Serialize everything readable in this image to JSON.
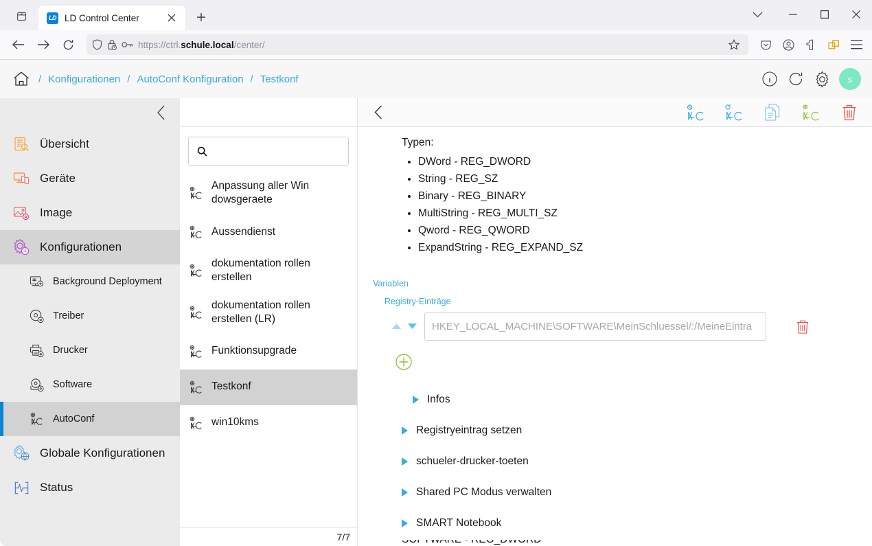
{
  "browser": {
    "tab": {
      "title": "LD Control Center",
      "favicon_text": "LD"
    },
    "list_all_tabs_tooltip": "List all tabs",
    "new_tab_label": "+",
    "url": {
      "scheme": "https://",
      "host_pre": "ctrl.",
      "host_bold": "schule.local",
      "path": "/center/"
    },
    "toolbar_icons": [
      "pocket-icon",
      "account-icon",
      "extensions-icon",
      "container-tabs-icon",
      "app-menu-icon"
    ],
    "nav_icons": [
      "back-icon",
      "forward-icon",
      "reload-icon"
    ],
    "window_controls": [
      "chevron-down-icon",
      "minimize-icon",
      "maximize-icon",
      "close-icon"
    ]
  },
  "app": {
    "breadcrumb": {
      "home_icon": "home-icon",
      "items": [
        "Konfigurationen",
        "AutoConf Konfiguration",
        "Testkonf"
      ],
      "separator": "/"
    },
    "header_actions": [
      "info-icon",
      "refresh-icon",
      "gear-icon"
    ],
    "avatar_initial": "s",
    "accent_blue": "#3aa9e8",
    "sidebar": {
      "collapse_icon": "chevron-left-icon",
      "items": [
        {
          "label": "Übersicht",
          "icon": "overview-icon",
          "level": "top",
          "active": false
        },
        {
          "label": "Geräte",
          "icon": "devices-icon",
          "level": "top",
          "active": false
        },
        {
          "label": "Image",
          "icon": "image-icon",
          "level": "top",
          "active": false
        },
        {
          "label": "Konfigurationen",
          "icon": "configurations-icon",
          "level": "top",
          "active": true
        },
        {
          "label": "Background Deployment",
          "icon": "background-deployment-icon",
          "level": "sub",
          "active": false
        },
        {
          "label": "Treiber",
          "icon": "driver-icon",
          "level": "sub",
          "active": false
        },
        {
          "label": "Drucker",
          "icon": "printer-icon",
          "level": "sub",
          "active": false
        },
        {
          "label": "Software",
          "icon": "software-icon",
          "level": "sub",
          "active": false
        },
        {
          "label": "AutoConf",
          "icon": "autoconf-icon",
          "level": "sub",
          "active": true
        },
        {
          "label": "Globale Konfigurationen",
          "icon": "global-configurations-icon",
          "level": "top",
          "active": false
        },
        {
          "label": "Status",
          "icon": "status-icon",
          "level": "top",
          "active": false
        }
      ]
    },
    "list_panel": {
      "collapse_icon": "chevron-left-icon",
      "search": {
        "placeholder": "",
        "value": "",
        "icon": "search-icon"
      },
      "items": [
        {
          "label": "Anpassung aller Win dowsgeraete",
          "selected": false
        },
        {
          "label": "Aussendienst",
          "selected": false
        },
        {
          "label": "dokumentation rollen erstellen",
          "selected": false
        },
        {
          "label": "dokumentation rollen erstellen (LR)",
          "selected": false
        },
        {
          "label": "Funktionsupgrade",
          "selected": false
        },
        {
          "label": "Testkonf",
          "selected": true
        },
        {
          "label": "win10kms",
          "selected": false
        }
      ],
      "counter": "7/7"
    },
    "main_panel": {
      "back_icon": "chevron-left-icon",
      "actions": [
        {
          "name": "autoconf-disable-icon",
          "color": "#3aa9e8"
        },
        {
          "name": "autoconf-refresh-icon",
          "color": "#3aa9e8"
        },
        {
          "name": "duplicate-icon",
          "color": "#8ec8ee"
        },
        {
          "name": "autoconf-settings-icon",
          "color": "#8cc63f"
        },
        {
          "name": "delete-icon",
          "color": "#ef5350"
        }
      ],
      "types_label": "Typen:",
      "types": [
        "DWord - REG_DWORD",
        "String - REG_SZ",
        "Binary - REG_BINARY",
        "MultiString - REG_MULTI_SZ",
        "Qword - REG_QWORD",
        "ExpandString - REG_EXPAND_SZ"
      ],
      "variables_label": "Variablen",
      "registry_label": "Registry-Einträge",
      "registry_rows": [
        {
          "placeholder": "HKEY_LOCAL_MACHINE\\SOFTWARE\\MeinSchluessel/:/MeineEintra",
          "value": "",
          "move_up_icon": "arrow-up-icon",
          "move_down_icon": "arrow-down-icon",
          "delete_icon": "delete-icon"
        }
      ],
      "add_icon": "add-circle-icon",
      "sections": [
        {
          "label": "Infos",
          "indent": true,
          "expanded": false
        },
        {
          "label": "Registryeintrag setzen",
          "indent": false,
          "expanded": false
        },
        {
          "label": "schueler-drucker-toeten",
          "indent": false,
          "expanded": false
        },
        {
          "label": "Shared PC Modus verwalten",
          "indent": false,
          "expanded": false
        },
        {
          "label": "SMART Notebook",
          "indent": false,
          "expanded": false
        }
      ],
      "cut_off_row": "SOFTWARE - REG_DWORD"
    }
  }
}
